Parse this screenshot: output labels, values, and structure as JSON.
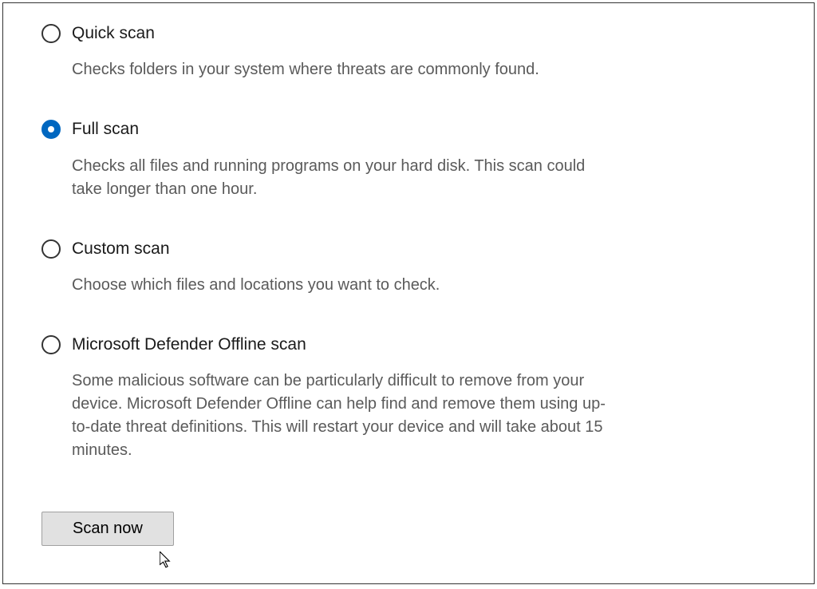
{
  "options": [
    {
      "title": "Quick scan",
      "desc": "Checks folders in your system where threats are commonly found.",
      "selected": false
    },
    {
      "title": "Full scan",
      "desc": "Checks all files and running programs on your hard disk. This scan could take longer than one hour.",
      "selected": true
    },
    {
      "title": "Custom scan",
      "desc": "Choose which files and locations you want to check.",
      "selected": false
    },
    {
      "title": "Microsoft Defender Offline scan",
      "desc": "Some malicious software can be particularly difficult to remove from your device. Microsoft Defender Offline can help find and remove them using up-to-date threat definitions. This will restart your device and will take about 15 minutes.",
      "selected": false
    }
  ],
  "button": {
    "scan_now": "Scan now"
  }
}
